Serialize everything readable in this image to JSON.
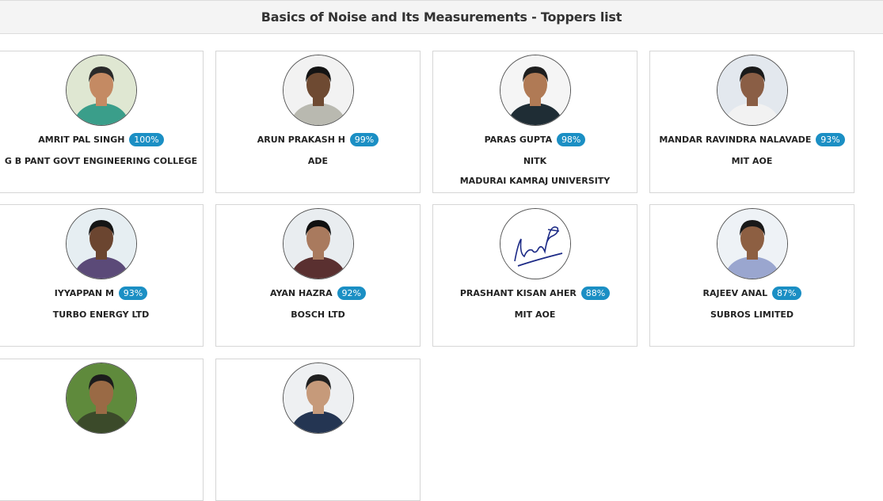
{
  "title": "Basics of Noise and Its Measurements - Toppers list",
  "toppers": [
    {
      "name": "AMRIT PAL SINGH",
      "score": "100%",
      "org": "G B PANT GOVT ENGINEERING COLLEGE",
      "org2": "",
      "photo": "student-photo",
      "colors": {
        "bg": "#dfe7d2",
        "shirt": "#3a9e8a",
        "skin": "#c48a63",
        "hair": "#2a2a2a"
      }
    },
    {
      "name": "ARUN PRAKASH H",
      "score": "99%",
      "org": "ADE",
      "org2": "",
      "photo": "man-photo",
      "colors": {
        "bg": "#f2f2f2",
        "shirt": "#b9b9b0",
        "skin": "#6e4a32",
        "hair": "#141414"
      }
    },
    {
      "name": "PARAS GUPTA",
      "score": "98%",
      "org": "NITK",
      "org2": "MADURAI KAMRAJ UNIVERSITY",
      "photo": "man-photo",
      "colors": {
        "bg": "#f5f5f5",
        "shirt": "#1f2d35",
        "skin": "#b07a55",
        "hair": "#1e1e1e"
      }
    },
    {
      "name": "MANDAR RAVINDRA NALAVADE",
      "score": "93%",
      "org": "MIT AOE",
      "org2": "",
      "photo": "man-photo",
      "colors": {
        "bg": "#e3e8ee",
        "shirt": "#f2f2f2",
        "skin": "#8a5e45",
        "hair": "#1a1a1a"
      }
    },
    {
      "name": "IYYAPPAN M",
      "score": "93%",
      "org": "TURBO ENERGY LTD",
      "org2": "",
      "photo": "man-photo",
      "colors": {
        "bg": "#e6eef2",
        "shirt": "#5b4a78",
        "skin": "#6b4530",
        "hair": "#151515"
      }
    },
    {
      "name": "AYAN HAZRA",
      "score": "92%",
      "org": "BOSCH LTD",
      "org2": "",
      "photo": "man-photo",
      "colors": {
        "bg": "#e9edf0",
        "shirt": "#5a3030",
        "skin": "#a97a5e",
        "hair": "#101010"
      }
    },
    {
      "name": "PRASHANT KISAN AHER",
      "score": "88%",
      "org": "MIT AOE",
      "org2": "",
      "photo": "signature-image",
      "colors": {
        "bg": "#ffffff",
        "shirt": "#1c2a86",
        "skin": "#1c2a86",
        "hair": "#1c2a86"
      }
    },
    {
      "name": "RAJEEV ANAL",
      "score": "87%",
      "org": "SUBROS LIMITED",
      "org2": "",
      "photo": "man-photo",
      "colors": {
        "bg": "#eef2f6",
        "shirt": "#9aa6cf",
        "skin": "#8d5f42",
        "hair": "#191919"
      }
    },
    {
      "name": "",
      "score": "",
      "org": "",
      "org2": "",
      "photo": "man-photo",
      "colors": {
        "bg": "#5f8a3c",
        "shirt": "#3b4a2a",
        "skin": "#9a6a45",
        "hair": "#1c1c1c"
      }
    },
    {
      "name": "",
      "score": "",
      "org": "",
      "org2": "",
      "photo": "man-photo",
      "colors": {
        "bg": "#eef0f2",
        "shirt": "#243552",
        "skin": "#c69a7a",
        "hair": "#202020"
      }
    }
  ]
}
